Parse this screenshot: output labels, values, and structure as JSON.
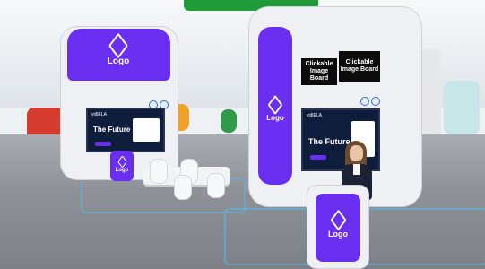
{
  "booth_left": {
    "logo_label": "Logo",
    "screen": {
      "brand": "vii8ELA",
      "headline": "The Future"
    }
  },
  "booth_right": {
    "logo_label": "Logo",
    "boards": [
      {
        "label": "Clickable Image Board"
      },
      {
        "label": "Clickable Image Board"
      }
    ],
    "screen": {
      "brand": "vii8ELA",
      "headline": "The Future"
    }
  },
  "podium": {
    "logo_label": "Logo"
  },
  "desk": {
    "logo_label": "Logo"
  },
  "colors": {
    "brand_purple": "#6a2ef0",
    "accent_green": "#1f9b3a",
    "floor_trim_blue": "#57b7e6"
  }
}
